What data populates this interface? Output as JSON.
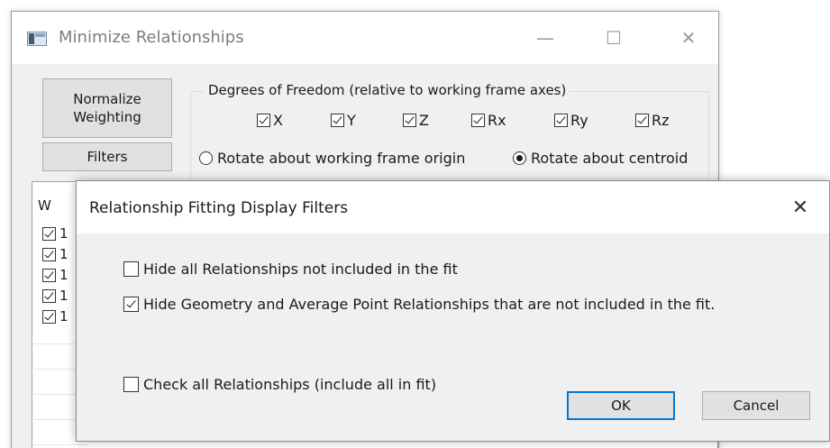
{
  "main_window": {
    "title": "Minimize Relationships",
    "controls": {
      "minimize": "—",
      "maximize": "☐",
      "close": "✕"
    },
    "normalize_button_label": "Normalize Weighting",
    "filters_button_label": "Filters",
    "dof_group": {
      "legend": "Degrees of Freedom (relative to working frame axes)",
      "axes": [
        {
          "label": "X",
          "checked": true
        },
        {
          "label": "Y",
          "checked": true
        },
        {
          "label": "Z",
          "checked": true
        },
        {
          "label": "Rx",
          "checked": true
        },
        {
          "label": "Ry",
          "checked": true
        },
        {
          "label": "Rz",
          "checked": true
        }
      ],
      "rotation_options": [
        {
          "label": "Rotate about working frame origin",
          "selected": false
        },
        {
          "label": "Rotate about centroid",
          "selected": true
        }
      ]
    },
    "list": {
      "header": "W",
      "rows": [
        {
          "text": "1",
          "checked": true
        },
        {
          "text": "1",
          "checked": true
        },
        {
          "text": "1",
          "checked": true
        },
        {
          "text": "1",
          "checked": true
        },
        {
          "text": "1",
          "checked": true
        }
      ]
    }
  },
  "dialog": {
    "title": "Relationship Fitting Display Filters",
    "close": "✕",
    "options": [
      {
        "label": "Hide all Relationships not included in the fit",
        "checked": false
      },
      {
        "label": "Hide Geometry and Average Point Relationships that are not included in the fit.",
        "checked": true
      },
      {
        "label": "Check all Relationships (include all in fit)",
        "checked": false
      }
    ],
    "ok_label": "OK",
    "cancel_label": "Cancel"
  },
  "colors": {
    "accent": "#0078d7",
    "dialog_bg": "#f0f0f0",
    "titlebar_bg": "#ffffff",
    "button_bg": "#e1e1e1"
  },
  "icons": {
    "app_icon": "app-window-icon",
    "close": "close-icon",
    "minimize": "minimize-icon",
    "maximize": "maximize-icon"
  }
}
